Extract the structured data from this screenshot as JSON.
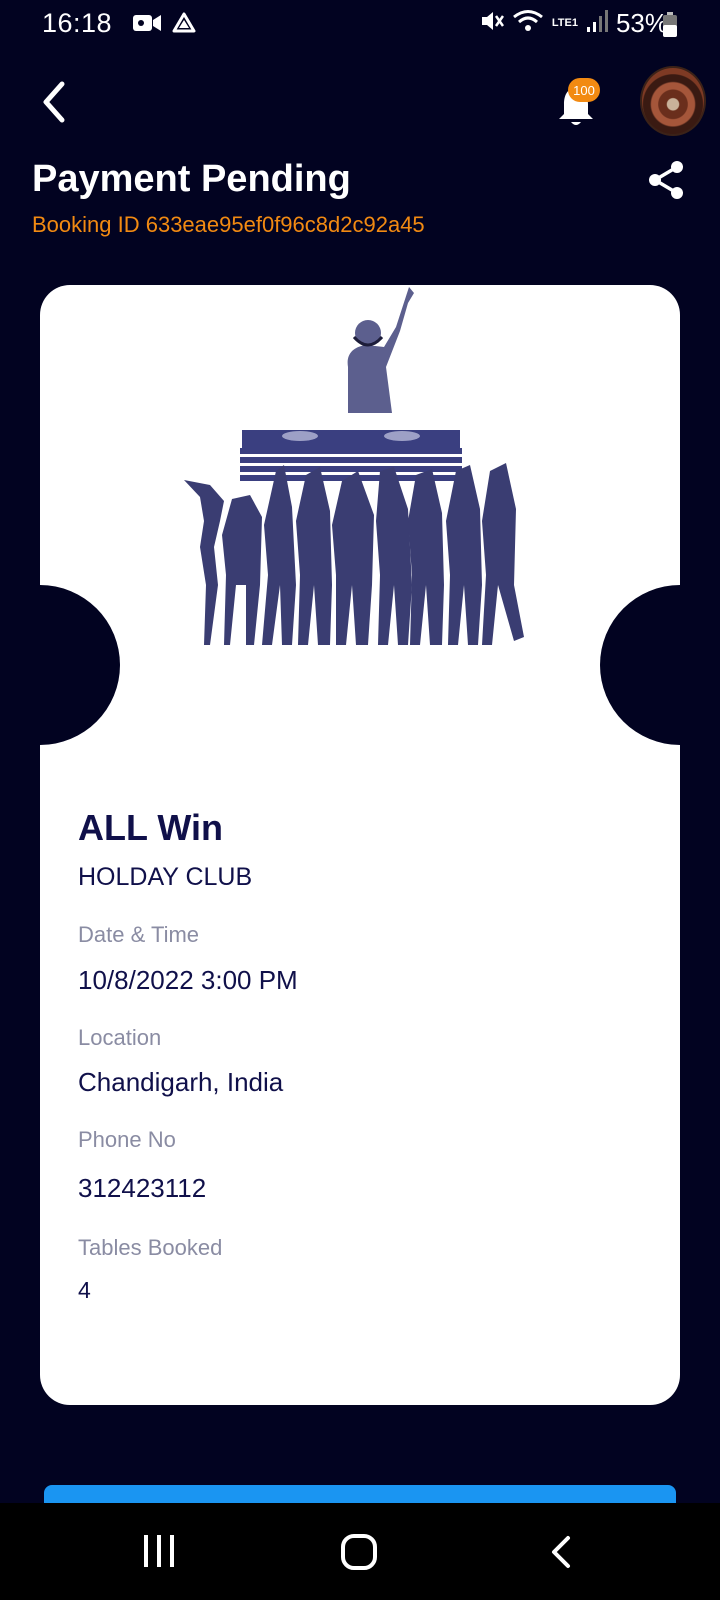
{
  "status_bar": {
    "time": "16:18",
    "battery": "53%",
    "network_label": "LTE1"
  },
  "header": {
    "notification_count": "100",
    "title": "Payment Pending",
    "booking_id": "Booking ID 633eae95ef0f96c8d2c92a45"
  },
  "ticket": {
    "event_name": "ALL Win",
    "venue": "HOLDAY CLUB",
    "fields": [
      {
        "label": "Date & Time",
        "value": "10/8/2022 3:00 PM"
      },
      {
        "label": "Location",
        "value": "Chandigarh, India"
      },
      {
        "label": "Phone No",
        "value": "312423112"
      },
      {
        "label": "Tables Booked",
        "value": "4"
      }
    ]
  },
  "colors": {
    "background": "#020321",
    "accent_orange": "#f28a12",
    "text_dark": "#10104a",
    "label_gray": "#8a8ca3",
    "button_blue": "#1a95f2"
  },
  "icons": [
    "back-arrow-icon",
    "bell-icon",
    "share-icon",
    "dj-party-illustration",
    "recent-apps-icon",
    "home-icon",
    "nav-back-icon"
  ]
}
